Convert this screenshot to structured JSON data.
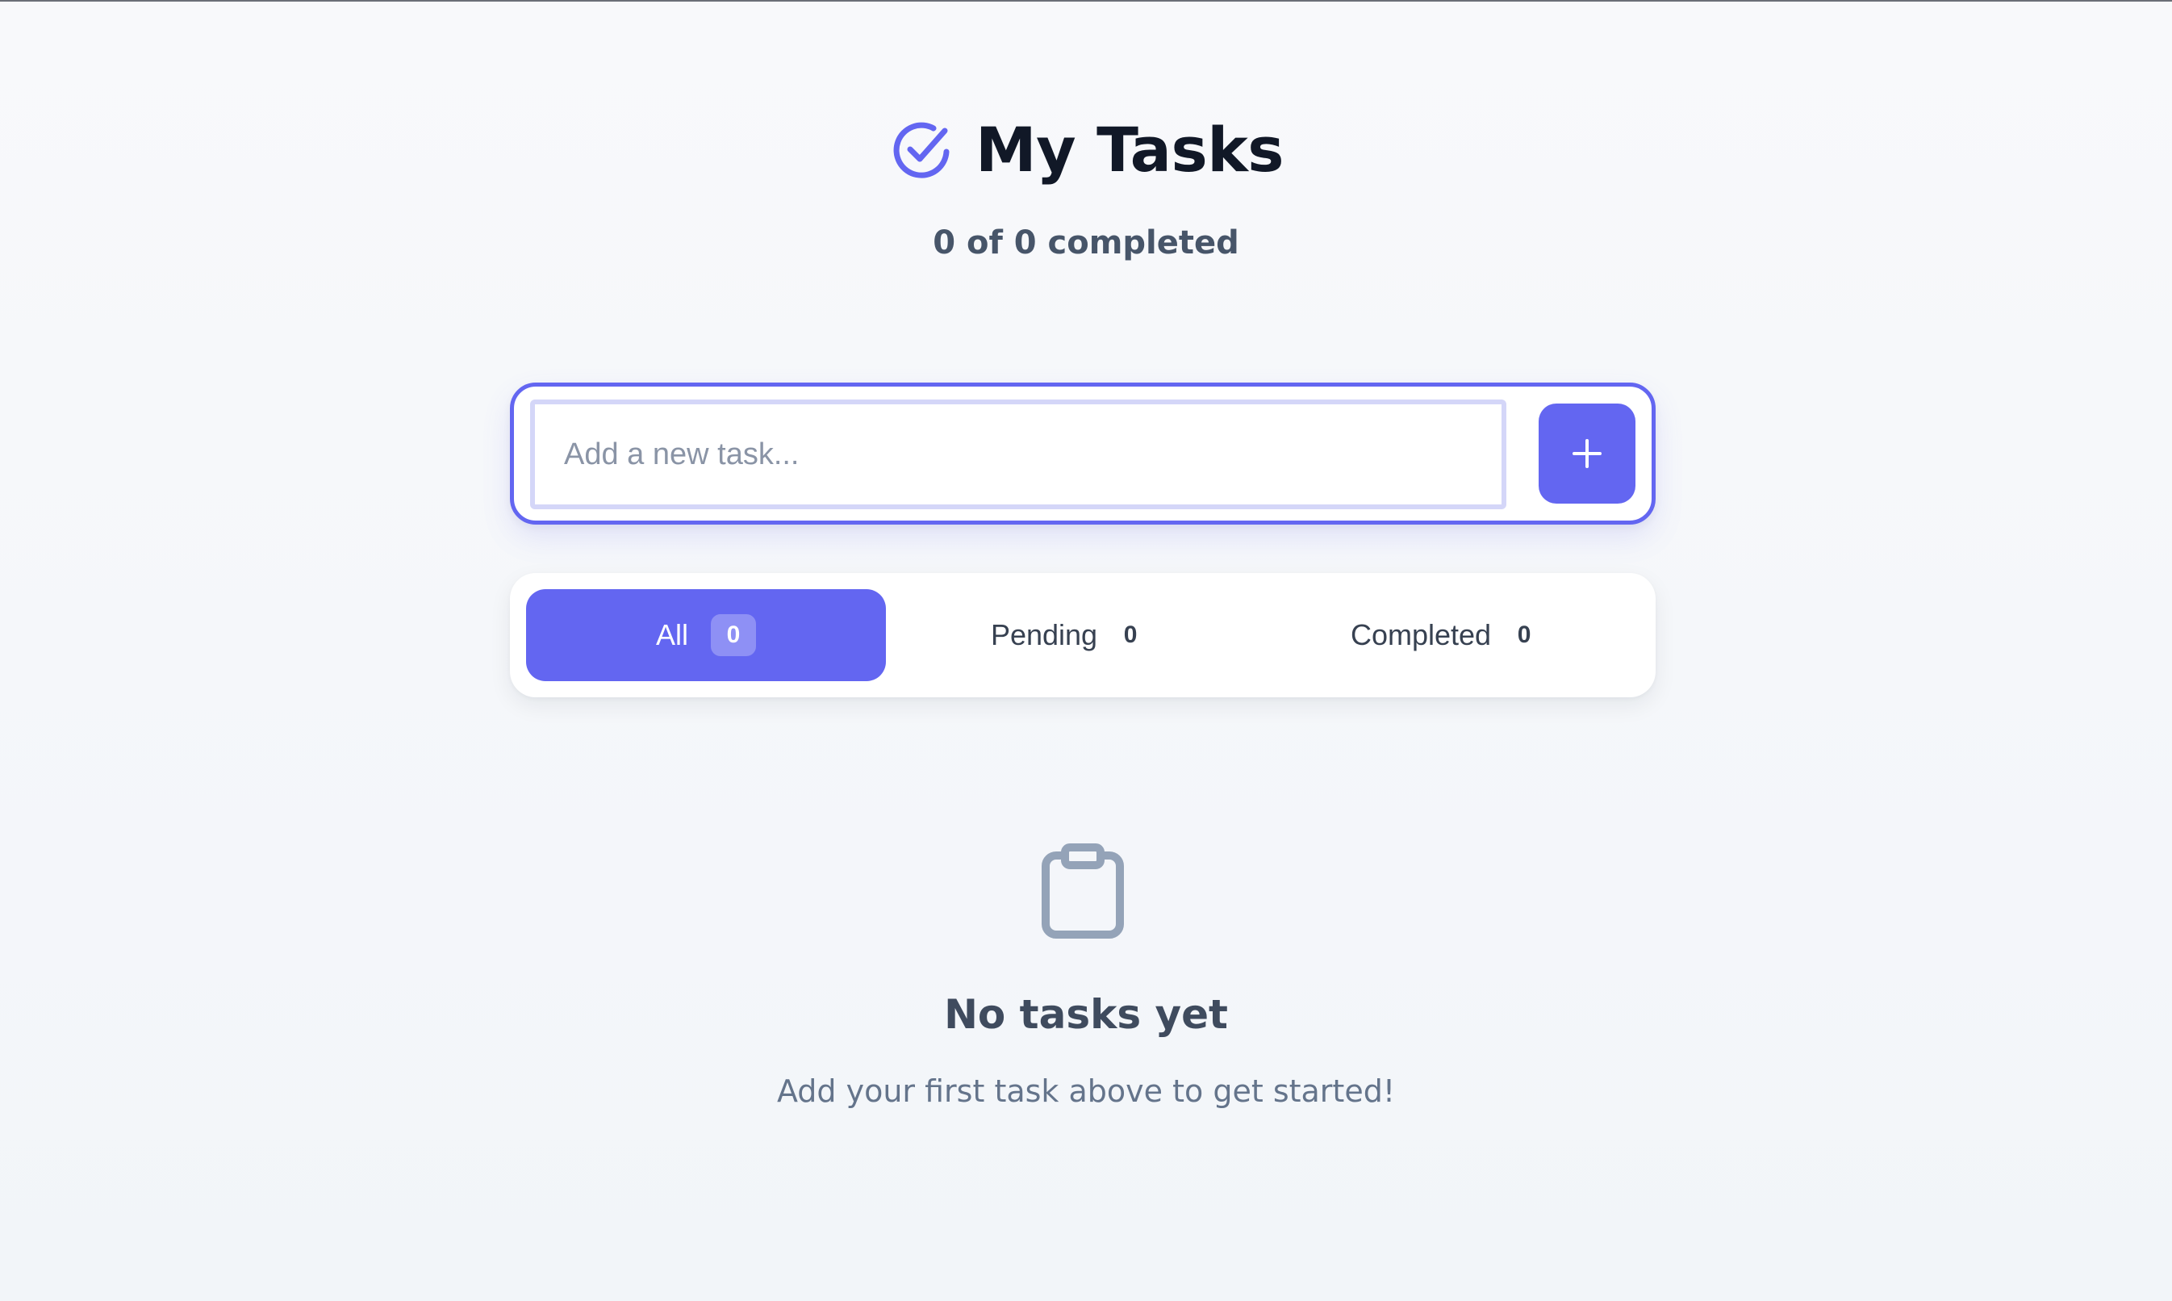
{
  "header": {
    "title": "My Tasks",
    "logo_icon": "check-circle-icon",
    "subtitle": "0 of 0 completed"
  },
  "input": {
    "placeholder": "Add a new task...",
    "value": "",
    "add_button_icon": "plus-icon"
  },
  "filters": [
    {
      "label": "All",
      "count": "0",
      "active": true
    },
    {
      "label": "Pending",
      "count": "0",
      "active": false
    },
    {
      "label": "Completed",
      "count": "0",
      "active": false
    }
  ],
  "empty_state": {
    "icon": "clipboard-icon",
    "title": "No tasks yet",
    "subtitle": "Add your first task above to get started!"
  },
  "colors": {
    "accent": "#6366f1",
    "title": "#111827",
    "muted": "#64748b",
    "background": "#f4f6f9"
  }
}
